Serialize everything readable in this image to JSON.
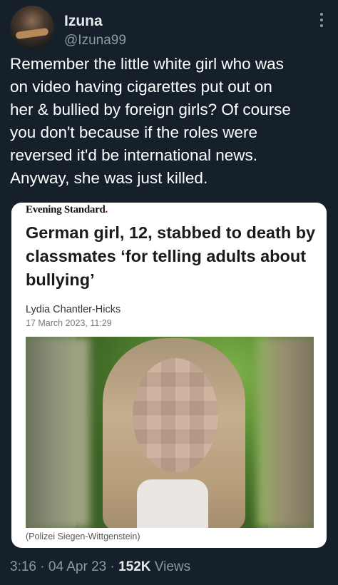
{
  "tweet": {
    "author_name": "Izuna",
    "author_handle": "@Izuna99",
    "text": "Remember the little white girl who was\non video having cigarettes put out on\nher & bullied by foreign girls? Of course\nyou don't because if the roles were\nreversed it'd be international news.\nAnyway, she was just killed."
  },
  "card": {
    "publication": "Evening Standard",
    "publication_dot": ".",
    "headline": "German girl, 12, stabbed to death by classmates ‘for telling adults about bullying’",
    "author": "Lydia Chantler-Hicks",
    "date": "17 March 2023, 11:29",
    "photo_caption": "(Polizei Siegen-Wittgenstein)"
  },
  "footer": {
    "time": "3:16",
    "separator1": " · ",
    "date": "04 Apr 23",
    "separator2": " · ",
    "views_count": "152K",
    "views_label": " Views"
  },
  "icons": {
    "more": "more-vertical-icon"
  }
}
